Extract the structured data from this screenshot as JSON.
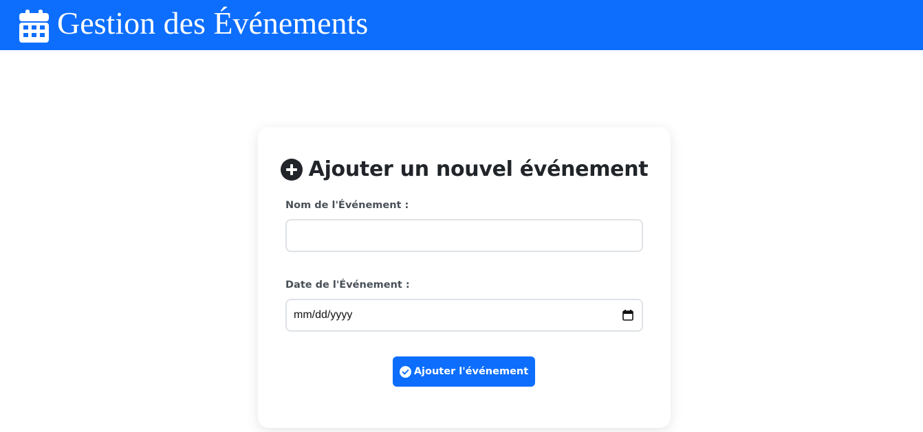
{
  "header": {
    "title": "Gestion des Événements",
    "icon": "calendar-icon",
    "background_color": "#0d6efd"
  },
  "form": {
    "title": "Ajouter un nouvel événement",
    "title_icon": "plus-circle-icon",
    "name_label": "Nom de l'Événement :",
    "name_value": "",
    "date_label": "Date de l'Événement :",
    "date_placeholder": "mm/dd/yyyy",
    "date_icon": "calendar-small-icon",
    "submit_label": "Ajouter l'événement",
    "submit_icon": "check-circle-icon",
    "accent_color": "#0d6efd"
  }
}
